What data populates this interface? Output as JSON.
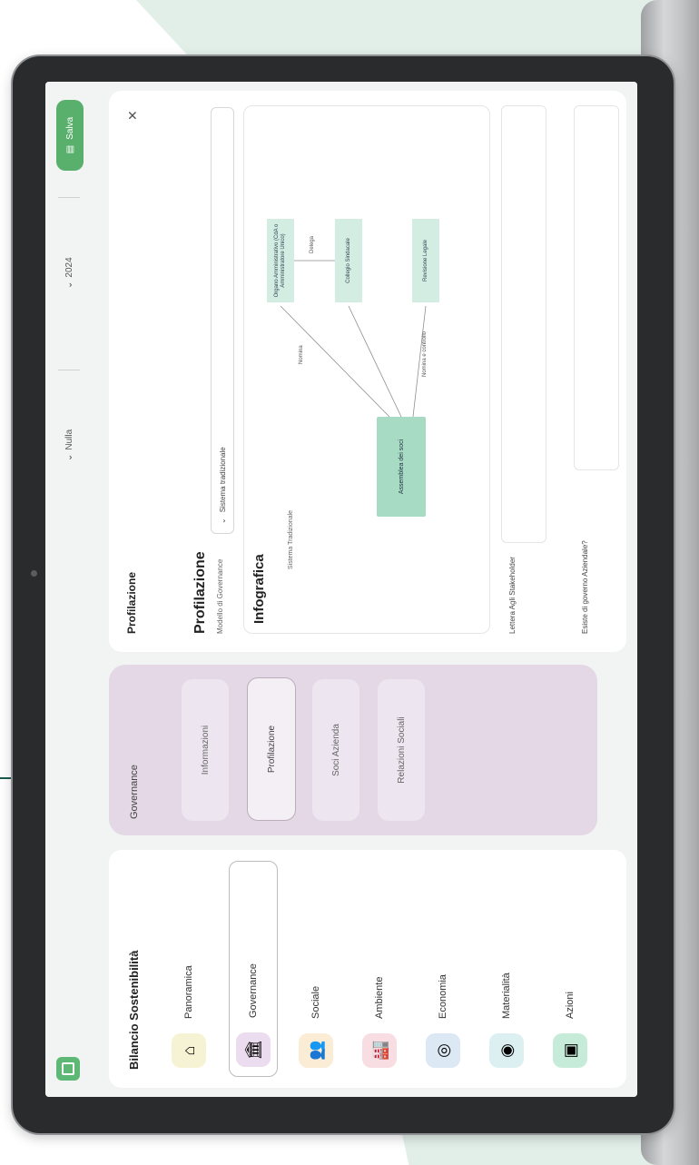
{
  "app": {
    "sidebar_title": "Bilancio Sostenibilità",
    "save_label": "Salva",
    "period_select": "Nulla",
    "year_select": "2024"
  },
  "sidebar": {
    "items": [
      {
        "label": "Panoramica",
        "icon": "home-icon",
        "color": "#f6f3d5",
        "glyph": "⌂",
        "active": false
      },
      {
        "label": "Governance",
        "icon": "institution-icon",
        "color": "#ecdcef",
        "glyph": "🏛",
        "active": true
      },
      {
        "label": "Sociale",
        "icon": "people-icon",
        "color": "#fbecd5",
        "glyph": "👥",
        "active": false
      },
      {
        "label": "Ambiente",
        "icon": "factory-icon",
        "color": "#f8dde3",
        "glyph": "🏭",
        "active": false
      },
      {
        "label": "Economia",
        "icon": "coins-icon",
        "color": "#dce8f4",
        "glyph": "◎",
        "active": false
      },
      {
        "label": "Materialità",
        "icon": "target-icon",
        "color": "#dcf0f2",
        "glyph": "◉",
        "active": false
      },
      {
        "label": "Azioni",
        "icon": "actions-icon",
        "color": "#c6ecd9",
        "glyph": "▣",
        "active": false
      }
    ]
  },
  "submenu": {
    "title": "Governance",
    "items": [
      {
        "label": "Informazioni",
        "active": false
      },
      {
        "label": "Profilazione",
        "active": true
      },
      {
        "label": "Soci Azienda",
        "active": false
      },
      {
        "label": "Relazioni Sociali",
        "active": false
      }
    ]
  },
  "main": {
    "header_title": "Profilazione",
    "section_title": "Profilazione",
    "model_label": "Modello di Governance",
    "model_value": "Sistema tradizionale",
    "infographic_title": "Infografica",
    "infographic_subtitle": "Sistema Tradizionale",
    "nodes": {
      "center": "Assemblea dei soci",
      "top": "Organo Amministrativo (CdA o Amministratore Unico)",
      "middle": "Collegio Sindacale",
      "bottom": "Revisione Legale",
      "label_top": "Nomina",
      "label_mid": "Delega",
      "label_bottom": "Nomina e controllo"
    },
    "question1": "Lettera Agli Stakeholder",
    "question2": "Esiste di governo Aziendale?"
  }
}
